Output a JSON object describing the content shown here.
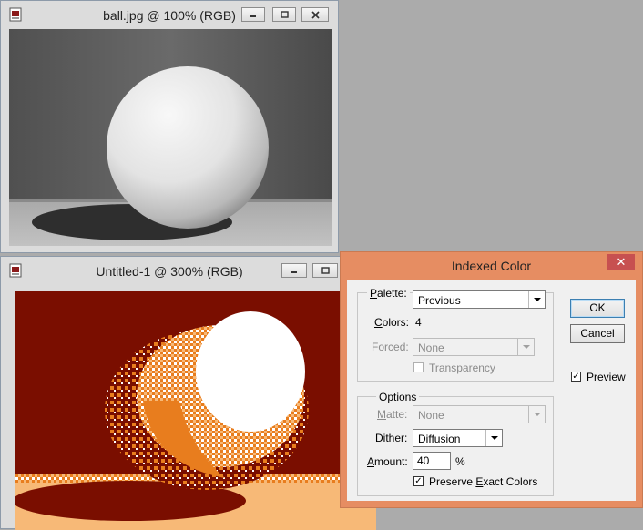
{
  "window_ball": {
    "title": "ball.jpg @ 100% (RGB)",
    "minimize_icon": "minimize-icon",
    "restore_icon": "restore-icon",
    "close_icon": "close-icon"
  },
  "window_untitled": {
    "title": "Untitled-1 @ 300% (RGB)",
    "minimize_icon": "minimize-icon",
    "restore_icon": "restore-icon"
  },
  "dialog": {
    "title": "Indexed Color",
    "close_glyph": "✕",
    "palette_label": "Palette:",
    "palette_value": "Previous",
    "colors_label": "Colors:",
    "colors_value": "4",
    "forced_label": "Forced:",
    "forced_value": "None",
    "transparency_label": "Transparency",
    "transparency_checked": false,
    "options_label": "Options",
    "matte_label": "Matte:",
    "matte_value": "None",
    "dither_label": "Dither:",
    "dither_value": "Diffusion",
    "amount_label": "Amount:",
    "amount_value": "40",
    "amount_unit": "%",
    "preserve_label": "Preserve Exact Colors",
    "preserve_checked": true,
    "ok_label": "OK",
    "cancel_label": "Cancel",
    "preview_label": "Preview",
    "preview_checked": true
  },
  "colors": {
    "dialog_frame": "#e68d62",
    "close_button": "#c75050",
    "indexed_dark_red": "#7a0e00",
    "indexed_orange": "#e87d1e",
    "indexed_white": "#ffffff",
    "indexed_peach": "#f7b977"
  }
}
